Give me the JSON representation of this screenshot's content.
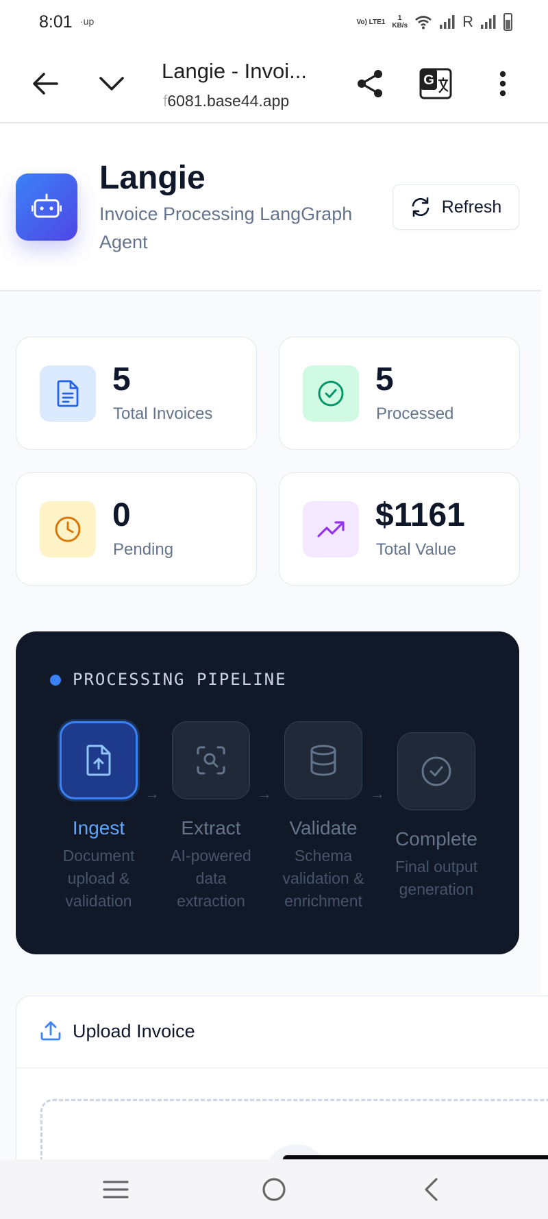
{
  "status_bar": {
    "time": "8:01",
    "up_label": "·up",
    "volte": "Vo) LTE1",
    "speed_value": "1",
    "speed_unit": "KB/s",
    "roaming": "R"
  },
  "browser": {
    "title": "Langie - Invoi...",
    "url_faded": "f",
    "url": "6081.base44.app"
  },
  "header": {
    "app_name": "Langie",
    "subtitle": "Invoice Processing LangGraph Agent",
    "refresh_label": "Refresh"
  },
  "stats": [
    {
      "value": "5",
      "label": "Total Invoices",
      "icon": "document-icon",
      "bg": "#dbeafe",
      "fg": "#2563eb"
    },
    {
      "value": "5",
      "label": "Processed",
      "icon": "check-circle-icon",
      "bg": "#d1fae5",
      "fg": "#059669"
    },
    {
      "value": "0",
      "label": "Pending",
      "icon": "clock-icon",
      "bg": "#fef3c7",
      "fg": "#d97706"
    },
    {
      "value": "$1161",
      "label": "Total Value",
      "icon": "trending-up-icon",
      "bg": "#f3e8ff",
      "fg": "#9333ea"
    }
  ],
  "pipeline": {
    "title": "PROCESSING PIPELINE",
    "steps": [
      {
        "title": "Ingest",
        "desc": "Document upload & validation",
        "icon": "file-upload-icon",
        "active": true
      },
      {
        "title": "Extract",
        "desc": "AI-powered data extraction",
        "icon": "scan-search-icon",
        "active": false
      },
      {
        "title": "Validate",
        "desc": "Schema validation & enrichment",
        "icon": "database-icon",
        "active": false
      },
      {
        "title": "Complete",
        "desc": "Final output generation",
        "icon": "check-circle-icon",
        "active": false
      }
    ],
    "arrow": "→"
  },
  "upload": {
    "title": "Upload Invoice"
  },
  "colors": {
    "accent": "#3b82f6",
    "pipeline_bg": "#111827"
  }
}
